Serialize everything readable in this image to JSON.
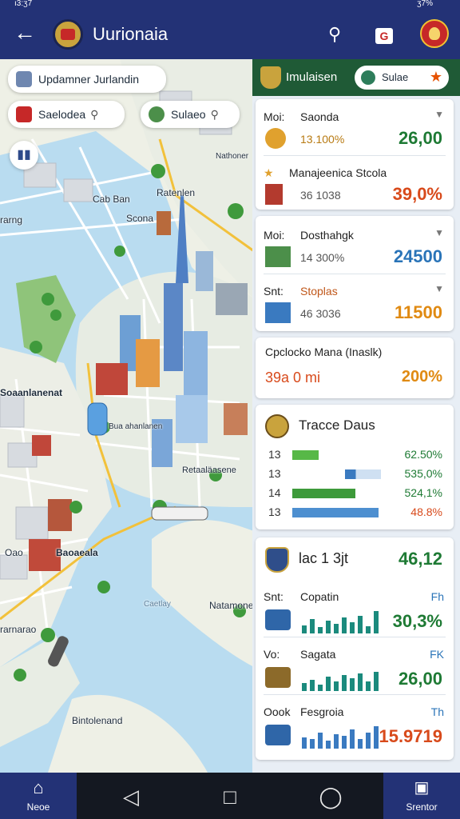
{
  "status": {
    "time": "ı3:ʒ7",
    "right_text": "ʒ7%"
  },
  "app_bar": {
    "title": "Uurionaia"
  },
  "map": {
    "search_chip": "Updamner Jurlandin",
    "chip_left": "Saelodea",
    "chip_right": "Sulaeo",
    "labels": {
      "nathoner": "Nathoner",
      "cab_ban": "Cab Ban",
      "ratenlen": "Ratenlen",
      "scona": "Scona",
      "rarng": "rarng",
      "soanlanenat": "Soaanlanenat",
      "bus_station": "Bua ahanlanen",
      "ratealasene": "Retaaläasene",
      "baoaeala": "Baoaeala",
      "oao": "Oao",
      "rarnaroa": "rarnarao",
      "natamones": "Natamones",
      "caetlay": "Caetlay",
      "bindolenand": "Bintolenand"
    }
  },
  "panel": {
    "header_title": "Imulaisen",
    "pill_text": "Sulae",
    "rows": [
      {
        "label": "Moi:",
        "name": "Saonda",
        "sub": "13.100%",
        "value": "26,00",
        "value_color": "#1e7a34",
        "sub_color": "#b87a12"
      },
      {
        "label": "",
        "name": "Manajeenica  Stcola",
        "sub": "36 1038",
        "value": "39,0%",
        "value_color": "#d84a1b",
        "sub_color": "#555555"
      },
      {
        "label": "Moi:",
        "name": "Dosthahgk",
        "sub": "14 300%",
        "value": "24500",
        "value_color": "#2a74b8",
        "sub_color": "#555555"
      },
      {
        "label": "Snt:",
        "name": "Stoplas",
        "sub": "46 3036",
        "value": "11500",
        "value_color": "#e08a12",
        "sub_color": "#555555"
      }
    ],
    "stat_card": {
      "title": "Cpclocko Mana (Inaslk)",
      "left": "39a 0 mi",
      "right": "200%"
    },
    "trade_card": {
      "title": "Tracce Daus",
      "rows": [
        {
          "label": "13",
          "value": "62.50%",
          "fill": 0.3,
          "color": "#57b847",
          "fill2": 0.0
        },
        {
          "label": "13",
          "value": "535,0%",
          "fill": 0.0,
          "color": "#57b847",
          "fill2": 0.5
        },
        {
          "label": "14",
          "value": "524,1%",
          "fill": 0.72,
          "color": "#3d9a3a",
          "fill2": 0.0
        },
        {
          "label": "13",
          "value": "48.8%",
          "fill": 0.98,
          "color": "#4d8fd0",
          "fill2": 0.0
        }
      ]
    },
    "bottom_card": {
      "title": "lac 1 3jt",
      "value": "46,12",
      "rows": [
        {
          "label": "Snt:",
          "name": "Copatin",
          "unit": "Fh",
          "value": "30,3%",
          "value_color": "#1e7a34",
          "bars": [
            10,
            18,
            8,
            16,
            12,
            20,
            14,
            22,
            9,
            28
          ]
        },
        {
          "label": "Vo:",
          "name": "Sagata",
          "unit": "FK",
          "value": "26,00",
          "value_color": "#1e7a34",
          "bars": [
            10,
            14,
            8,
            18,
            12,
            20,
            16,
            22,
            12,
            24
          ]
        },
        {
          "label": "Oook",
          "name": "Fesgroia",
          "unit": "Th",
          "value": "15.9719",
          "value_color": "#d84a1b",
          "bars": [
            14,
            12,
            20,
            10,
            18,
            16,
            24,
            12,
            20,
            28
          ]
        }
      ]
    }
  },
  "nav": {
    "home": "Neoe",
    "right": "Srentor"
  },
  "colors": {
    "app_bar": "#233276",
    "panel_header": "#1f5a36",
    "water": "#b9dcf0"
  }
}
